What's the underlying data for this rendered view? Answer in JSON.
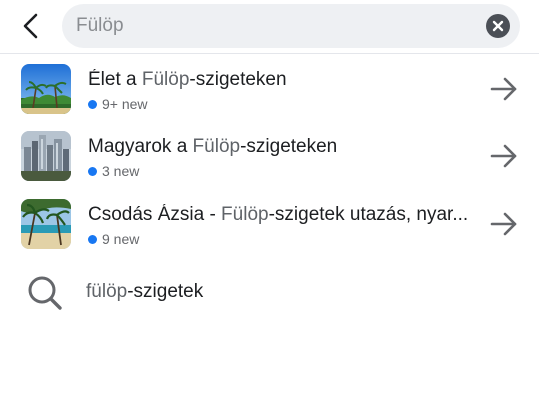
{
  "search": {
    "value": "Fülöp",
    "placeholder": "Fülöp"
  },
  "results": [
    {
      "title_prefix": "Élet a ",
      "title_match": "Fülöp",
      "title_suffix": "-szigeteken",
      "badge": "9+ new",
      "thumb_icon": "beach-palms-sky-image"
    },
    {
      "title_prefix": "Magyarok a ",
      "title_match": "Fülöp",
      "title_suffix": "-szigeteken",
      "badge": "3 new",
      "thumb_icon": "city-skyline-image"
    },
    {
      "title_prefix": "Csodás Ázsia - ",
      "title_match": "Fülöp",
      "title_suffix": "-szigetek utazás, nyar...",
      "badge": "9 new",
      "thumb_icon": "tropical-beach-image"
    }
  ],
  "suggestion": {
    "match": "fülöp",
    "suffix": "-szigetek"
  },
  "colors": {
    "accent": "#1877f2",
    "search_bg": "#eef0f3",
    "icon_dark": "#4b4f56"
  }
}
